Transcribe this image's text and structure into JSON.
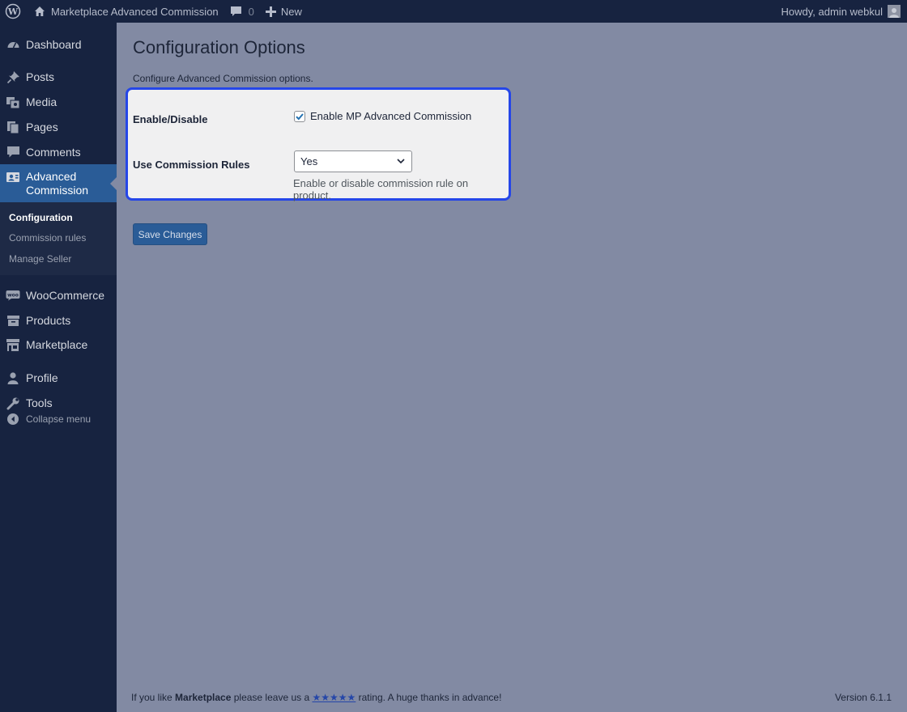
{
  "adminbar": {
    "site_name": "Marketplace Advanced Commission",
    "comments_count": "0",
    "new_label": "New",
    "greeting": "Howdy, admin webkul"
  },
  "sidebar": {
    "items": [
      {
        "label": "Dashboard",
        "icon": "dashboard-icon"
      },
      {
        "label": "Posts",
        "icon": "pin-icon"
      },
      {
        "label": "Media",
        "icon": "media-icon"
      },
      {
        "label": "Pages",
        "icon": "pages-icon"
      },
      {
        "label": "Comments",
        "icon": "comment-icon"
      },
      {
        "label": "Advanced Commission",
        "icon": "commission-icon"
      },
      {
        "label": "WooCommerce",
        "icon": "woo-icon"
      },
      {
        "label": "Products",
        "icon": "archive-icon"
      },
      {
        "label": "Marketplace",
        "icon": "store-icon"
      },
      {
        "label": "Profile",
        "icon": "user-icon"
      },
      {
        "label": "Tools",
        "icon": "wrench-icon"
      }
    ],
    "submenu": [
      "Configuration",
      "Commission rules",
      "Manage Seller"
    ],
    "collapse_label": "Collapse menu"
  },
  "main": {
    "title": "Configuration Options",
    "description": "Configure Advanced Commission options.",
    "fields": {
      "enable_label": "Enable/Disable",
      "enable_checkbox_label": "Enable MP Advanced Commission",
      "enable_checked": true,
      "rules_label": "Use Commission Rules",
      "rules_value": "Yes",
      "rules_help": "Enable or disable commission rule on product."
    },
    "save_label": "Save Changes"
  },
  "footer": {
    "prefix": "If you like ",
    "brand": "Marketplace",
    "middle": " please leave us a ",
    "stars": "★★★★★",
    "suffix": " rating. A huge thanks in advance!",
    "version": "Version 6.1.1"
  },
  "colors": {
    "adminbar_bg": "#172340",
    "content_bg": "#828aa3",
    "accent": "#2a5c97",
    "highlight_border": "#2546e8"
  }
}
